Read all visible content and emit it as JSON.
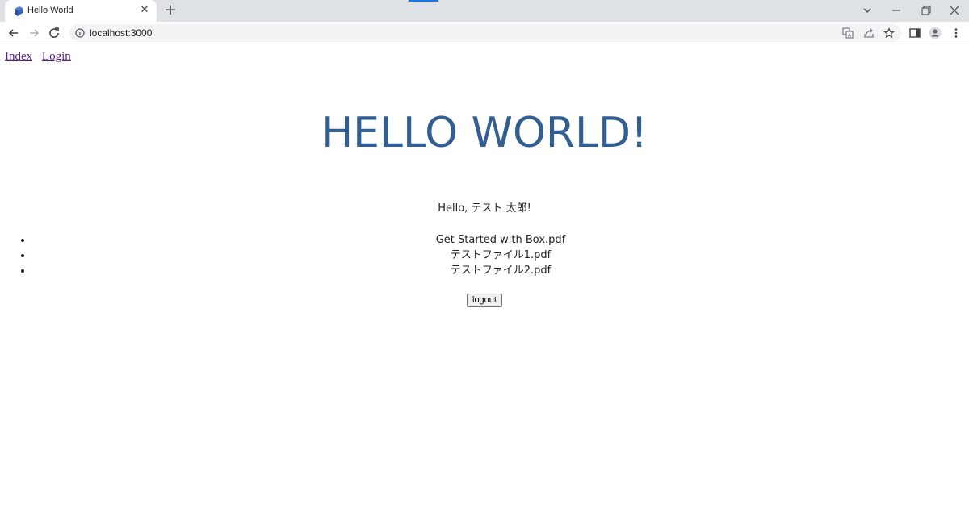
{
  "browser": {
    "tab": {
      "title": "Hello World",
      "favicon": "app-logo-icon",
      "close_icon": "close-icon"
    },
    "new_tab_icon": "plus-icon",
    "window_controls": [
      "tab-search-icon",
      "minimize-icon",
      "restore-icon",
      "close-window-icon"
    ],
    "toolbar": {
      "nav_icons": [
        "back-arrow-icon",
        "forward-arrow-icon",
        "reload-icon"
      ],
      "site_info_icon": "info-icon",
      "url": "localhost:3000",
      "omnibox_icons": [
        "translate-icon",
        "share-icon",
        "bookmark-star-icon"
      ],
      "right_icons": [
        "side-panel-icon",
        "profile-avatar-icon",
        "menu-kebab-icon"
      ]
    },
    "accent_color": "#1a73e8"
  },
  "page": {
    "nav_links": [
      {
        "label": "Index"
      },
      {
        "label": "Login"
      }
    ],
    "headline": "HELLO WORLD!",
    "headline_color": "#325e92",
    "greeting": "Hello, テスト 太郎!",
    "files": [
      {
        "name": "Get Started with Box.pdf"
      },
      {
        "name": "テストファイル1.pdf"
      },
      {
        "name": "テストファイル2.pdf"
      }
    ],
    "logout_label": "logout"
  }
}
